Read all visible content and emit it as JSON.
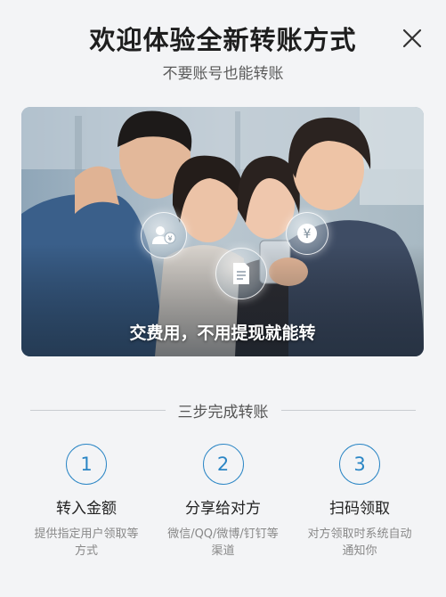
{
  "header": {
    "title": "欢迎体验全新转账方式",
    "subtitle": "不要账号也能转账"
  },
  "icons": {
    "close": "close-icon",
    "users": "users-coin-icon",
    "yuan": "yuan-icon",
    "document": "document-icon"
  },
  "hero": {
    "caption": "交费用，不用提现就能转"
  },
  "section": {
    "divider_label": "三步完成转账"
  },
  "steps": [
    {
      "number": "1",
      "title": "转入金额",
      "description": "提供指定用户领取等方式"
    },
    {
      "number": "2",
      "title": "分享给对方",
      "description": "微信/QQ/微博/钉钉等渠道"
    },
    {
      "number": "3",
      "title": "扫码领取",
      "description": "对方领取时系统自动通知你"
    }
  ],
  "colors": {
    "accent": "#2b86c5",
    "background": "#f3f4f6"
  }
}
